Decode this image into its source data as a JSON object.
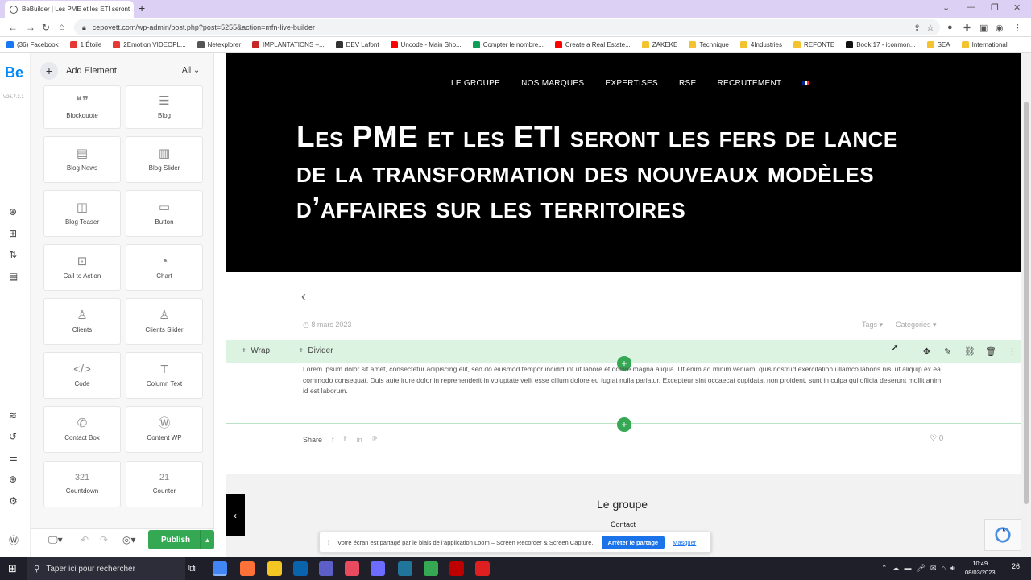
{
  "browser": {
    "tab_title": "BeBuilder | Les PME et les ETI seront",
    "url": "cepovett.com/wp-admin/post.php?post=5255&action=mfn-live-builder",
    "bookmarks": [
      {
        "label": "(36) Facebook",
        "color": "#1877f2"
      },
      {
        "label": "1 Étoile",
        "color": "#e53935"
      },
      {
        "label": "2Emotion VIDEOPL...",
        "color": "#e53935"
      },
      {
        "label": "Netexplorer",
        "color": "#555555"
      },
      {
        "label": "IMPLANTATIONS –...",
        "color": "#c62828"
      },
      {
        "label": "DEV Lafont",
        "color": "#333333"
      },
      {
        "label": "Uncode - Main Sho...",
        "color": "#ff0000"
      },
      {
        "label": "Compter le nombre...",
        "color": "#0f9d58"
      },
      {
        "label": "Create a Real Estate...",
        "color": "#ff0000"
      },
      {
        "label": "ZAKEKE",
        "color": "#f4c430"
      },
      {
        "label": "Technique",
        "color": "#f4c430"
      },
      {
        "label": "4Industries",
        "color": "#f4c430"
      },
      {
        "label": "REFONTE",
        "color": "#f4c430"
      },
      {
        "label": "Book 17 - iconmon...",
        "color": "#111111"
      },
      {
        "label": "SEA",
        "color": "#f4c430"
      },
      {
        "label": "International",
        "color": "#f4c430"
      }
    ]
  },
  "builder": {
    "logo": "Be",
    "version": "V26.7.3.1",
    "add_element": "Add Element",
    "filter": "All",
    "elements": [
      "Blockquote",
      "Blog",
      "Blog News",
      "Blog Slider",
      "Blog Teaser",
      "Button",
      "Call to Action",
      "Chart",
      "Clients",
      "Clients Slider",
      "Code",
      "Column Text",
      "Contact Box",
      "Content WP",
      "Countdown",
      "Counter"
    ],
    "counter_glyphs": {
      "countdown": "321",
      "counter": "21"
    },
    "publish": "Publish"
  },
  "page": {
    "menu": [
      "LE GROUPE",
      "NOS MARQUES",
      "EXPERTISES",
      "RSE",
      "RECRUTEMENT"
    ],
    "title": "Les PME et les ETI seront les fers de lance de la transformation des nouveaux modèles d’affaires sur les territoires",
    "date": "8 mars 2023",
    "tags": "Tags",
    "categories": "Categories",
    "wrap": "Wrap",
    "divider": "Divider",
    "lorem": "Lorem ipsum dolor sit amet, consectetur adipiscing elit, sed do eiusmod tempor incididunt ut labore et dolore magna aliqua. Ut enim ad minim veniam, quis nostrud exercitation ullamco laboris nisi ut aliquip ex ea commodo consequat. Duis aute irure dolor in reprehenderit in voluptate velit esse cillum dolore eu fugiat nulla pariatur. Excepteur sint occaecat cupidatat non proident, sunt in culpa qui officia deserunt mollit anim id est laborum.",
    "share": "Share",
    "likes": "0",
    "footer_title": "Le groupe",
    "footer_link": "Contact"
  },
  "loom": {
    "message": "Votre écran est partagé par le biais de l'application Loom – Screen Recorder & Screen Capture.",
    "stop": "Arrêter le partage",
    "hide": "Masquer"
  },
  "taskbar": {
    "search": "Taper ici pour rechercher",
    "time": "10:49",
    "date": "08/03/2023",
    "notif": "26"
  }
}
